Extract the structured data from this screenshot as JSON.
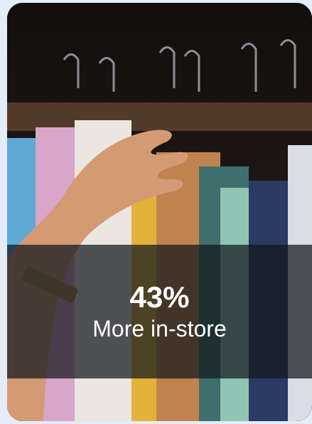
{
  "card": {
    "image_description_icon": "clothing-rack-photo",
    "stat": {
      "value": "43%",
      "label": "More in-store"
    }
  },
  "colors": {
    "page_background": "#e4ecf8",
    "overlay": "#12161c",
    "text": "#ffffff"
  }
}
